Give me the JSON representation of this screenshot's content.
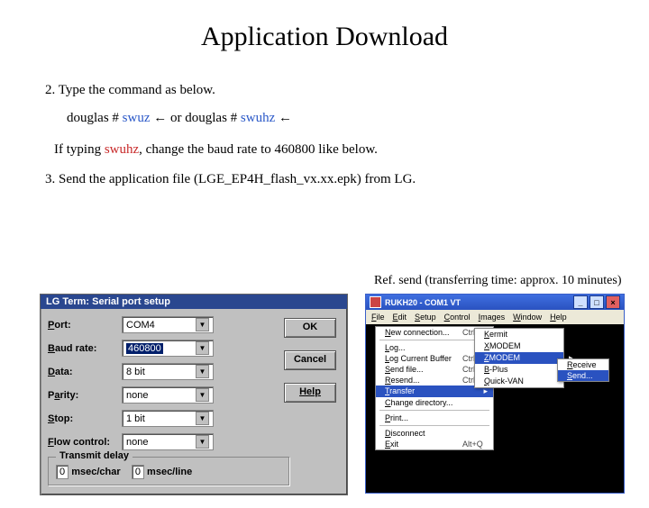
{
  "title": "Application Download",
  "step2": "2. Type the command as below.",
  "cmd_prefix1": "douglas # ",
  "cmd1": "swuz",
  "cmd_mid": "  ← or d",
  "cmd_prefix2": "ouglas # ",
  "cmd2": "swuhz",
  "cmd_tail": "  ←",
  "swuhz_note1": "If typing ",
  "swuhz_note2": "swuhz",
  "swuhz_note3": ", change the baud rate to 460800 like below.",
  "step3": "3. Send the application file (LGE_EP4H_flash_vx.xx.epk) from LG.",
  "ref_note": "Ref. send (transferring time: approx. 10 minutes)",
  "dialog": {
    "title": "LG Term: Serial port setup",
    "labels": {
      "port": "Port:",
      "baud": "Baud rate:",
      "data": "Data:",
      "parity": "Parity:",
      "stop": "Stop:",
      "flow": "Flow control:"
    },
    "values": {
      "port": "COM4",
      "baud": "460800",
      "data": "8 bit",
      "parity": "none",
      "stop": "1 bit",
      "flow": "none"
    },
    "buttons": {
      "ok": "OK",
      "cancel": "Cancel",
      "help": "Help"
    },
    "transmit": {
      "group": "Transmit delay",
      "char_val": "0",
      "char_lbl": "msec/char",
      "line_val": "0",
      "line_lbl": "msec/line"
    }
  },
  "terminal": {
    "title": "RUKH20 - COM1 VT",
    "menus": [
      "File",
      "Edit",
      "Setup",
      "Control",
      "Images",
      "Window",
      "Help"
    ],
    "file_menu": [
      {
        "l": "New connection...",
        "a": "Ctrl+N"
      },
      {
        "sep": true
      },
      {
        "l": "Log...",
        "a": ""
      },
      {
        "l": "Log Current Buffer",
        "a": "Ctrl+Alt+B"
      },
      {
        "l": "Send file...",
        "a": "Ctrl+S"
      },
      {
        "l": "Resend...",
        "a": "Ctrl+R"
      },
      {
        "l": "Transfer",
        "hl": true,
        "sub": true
      },
      {
        "l": "Change directory...",
        "a": ""
      },
      {
        "sep": true
      },
      {
        "l": "Print...",
        "a": ""
      },
      {
        "sep": true
      },
      {
        "l": "Disconnect",
        "a": ""
      },
      {
        "l": "Exit",
        "a": "Alt+Q"
      }
    ],
    "sub1": [
      {
        "l": "Kermit",
        "sub": true
      },
      {
        "l": "XMODEM",
        "sub": true
      },
      {
        "l": "ZMODEM",
        "sub": true,
        "hl": true
      },
      {
        "l": "B-Plus",
        "sub": true
      },
      {
        "l": "Quick-VAN",
        "sub": true
      }
    ],
    "sub2": [
      {
        "l": "Receive"
      },
      {
        "l": "Send...",
        "hl": true
      }
    ]
  }
}
